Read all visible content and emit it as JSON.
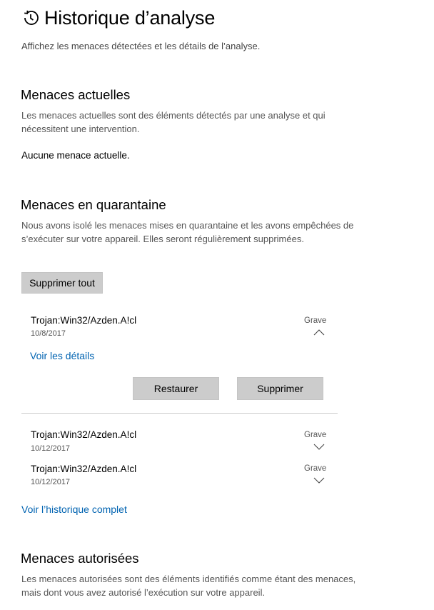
{
  "header": {
    "title": "Historique d’analyse",
    "subtitle": "Affichez les menaces détectées et les détails de l’analyse.",
    "icon": "history-icon"
  },
  "current_threats": {
    "heading": "Menaces actuelles",
    "description": "Les menaces actuelles sont des éléments détectés par une analyse et qui nécessitent une intervention.",
    "status": "Aucune menace actuelle."
  },
  "quarantined": {
    "heading": "Menaces en quarantaine",
    "description": "Nous avons isolé les menaces mises en quarantaine et les avons empêchées de s’exécuter sur votre appareil. Elles seront régulièrement supprimées.",
    "remove_all_label": "Supprimer tout",
    "items": [
      {
        "name": "Trojan:Win32/Azden.A!cl",
        "date": "10/8/2017",
        "severity": "Grave",
        "expanded": true,
        "details_link": "Voir les détails",
        "restore_label": "Restaurer",
        "remove_label": "Supprimer"
      },
      {
        "name": "Trojan:Win32/Azden.A!cl",
        "date": "10/12/2017",
        "severity": "Grave",
        "expanded": false
      },
      {
        "name": "Trojan:Win32/Azden.A!cl",
        "date": "10/12/2017",
        "severity": "Grave",
        "expanded": false
      }
    ],
    "full_history_link": "Voir l’historique complet"
  },
  "allowed_threats": {
    "heading": "Menaces autorisées",
    "description": "Les menaces autorisées sont des éléments identifiés comme étant des menaces, mais dont vous avez autorisé l’exécution sur votre appareil."
  },
  "colors": {
    "link": "#0063b1",
    "button_bg": "#cccccc",
    "secondary_text": "#555555"
  }
}
